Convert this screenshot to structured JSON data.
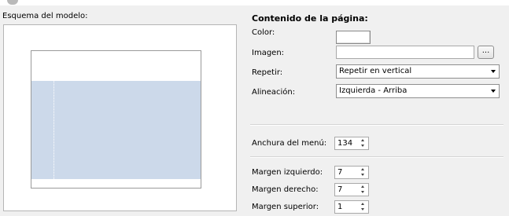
{
  "preview": {
    "label": "Esquema del modelo:"
  },
  "content": {
    "title": "Contenido de la página:",
    "color_label": "Color:",
    "color_value": "#ffffff",
    "image_label": "Imagen:",
    "image_value": "",
    "browse_label": "...",
    "repeat_label": "Repetir:",
    "repeat_value": "Repetir en vertical",
    "align_label": "Alineación:",
    "align_value": "Izquierda - Arriba",
    "menu_width_label": "Anchura del menú:",
    "menu_width_value": "134",
    "margin_left_label": "Margen izquierdo:",
    "margin_left_value": "7",
    "margin_right_label": "Margen derecho:",
    "margin_right_value": "7",
    "margin_top_label": "Margen superior:",
    "margin_top_value": "1"
  },
  "colors": {
    "content_area": "#ccd9ea",
    "panel_bg": "#f0f0f0"
  }
}
